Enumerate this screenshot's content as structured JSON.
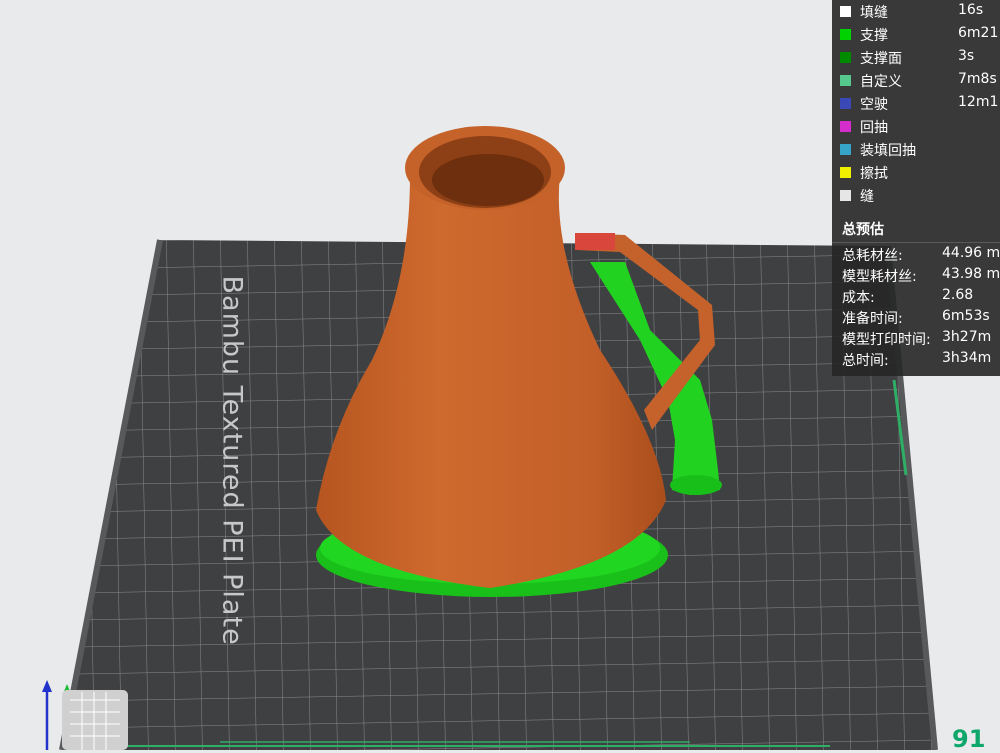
{
  "legend": {
    "items": [
      {
        "name": "填缝",
        "time": "16s",
        "color": "#ffffff"
      },
      {
        "name": "支撑",
        "time": "6m21",
        "color": "#00d200"
      },
      {
        "name": "支撑面",
        "time": "3s",
        "color": "#008a00"
      },
      {
        "name": "自定义",
        "time": "7m8s",
        "color": "#56c88d"
      },
      {
        "name": "空驶",
        "time": "12m1",
        "color": "#3b49b6"
      },
      {
        "name": "回抽",
        "time": "",
        "color": "#d42dcc"
      },
      {
        "name": "装填回抽",
        "time": "",
        "color": "#36a3c8"
      },
      {
        "name": "擦拭",
        "time": "",
        "color": "#f0f000"
      },
      {
        "name": "缝",
        "time": "",
        "color": "#e6e6e6"
      }
    ]
  },
  "summary": {
    "title": "总预估",
    "rows": [
      {
        "key": "总耗材丝:",
        "value": "44.96 m"
      },
      {
        "key": "模型耗材丝:",
        "value": "43.98 m"
      },
      {
        "key": "成本:",
        "value": "2.68"
      },
      {
        "key": "准备时间:",
        "value": "6m53s"
      },
      {
        "key": "模型打印时间:",
        "value": "3h27m"
      },
      {
        "key": "总时间:",
        "value": "3h34m"
      }
    ]
  },
  "plate": {
    "label": "Bambu Textured PEI Plate"
  },
  "layer": {
    "value": "91"
  },
  "colors": {
    "model": "#c8642a",
    "support": "#1ed21e",
    "plate": "#3f4042",
    "grid": "#7c7e80"
  }
}
